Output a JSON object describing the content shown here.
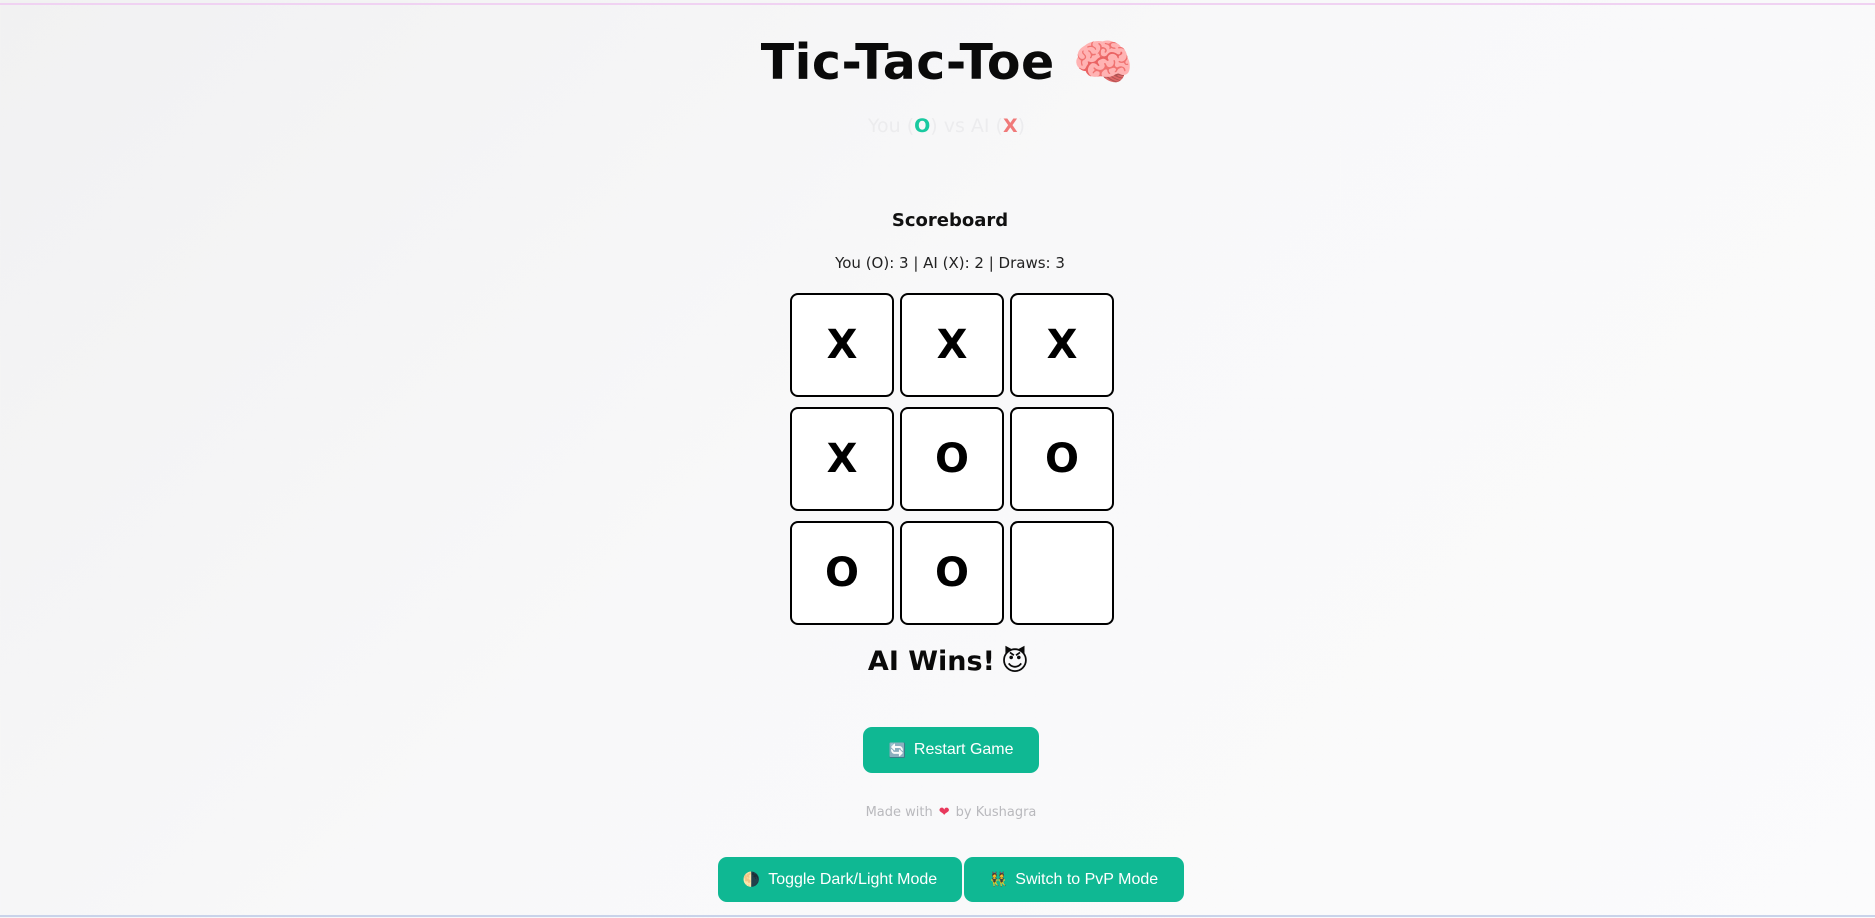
{
  "title": {
    "text": "Tic-Tac-Toe",
    "emoji": "🧠"
  },
  "subtitle": {
    "prefix": "You (",
    "player_mark": "O",
    "middle": ") vs AI (",
    "ai_mark": "X",
    "suffix": ")"
  },
  "scoreboard": {
    "heading": "Scoreboard",
    "line": "You (O): 3 | AI (X): 2 | Draws: 3"
  },
  "board": {
    "cells": [
      "X",
      "X",
      "X",
      "X",
      "O",
      "O",
      "O",
      "O",
      ""
    ]
  },
  "status": {
    "text": "AI Wins!",
    "emoji": "😈"
  },
  "buttons": {
    "restart": {
      "icon": "🔄",
      "label": "Restart Game"
    },
    "toggle_theme": {
      "icon": "🌗",
      "label": "Toggle Dark/Light Mode"
    },
    "pvp": {
      "icon": "👯",
      "label": "Switch to PvP Mode"
    }
  },
  "footer": {
    "prefix": "Made with",
    "heart": "❤",
    "suffix": "by Kushagra"
  },
  "colors": {
    "accent": "#0fb893",
    "player_mark": "#19c9a0",
    "ai_mark": "#f07a7a",
    "heart": "#e8385c"
  }
}
